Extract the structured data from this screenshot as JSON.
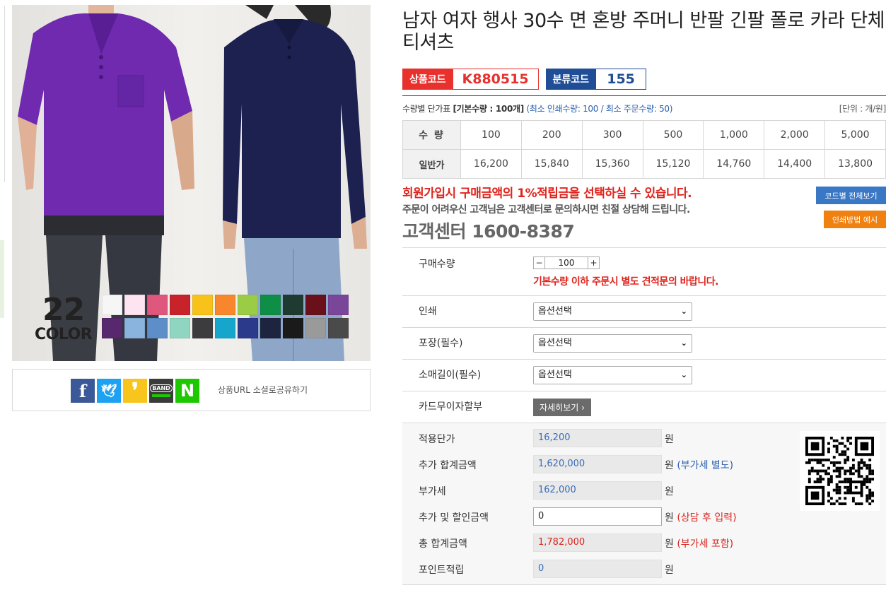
{
  "product": {
    "title": "남자 여자 행사 30수 면 혼방 주머니 반팔 긴팔 폴로 카라 단체 티셔츠",
    "code_label": "상품코드",
    "code_value": "K880515",
    "category_label": "분류코드",
    "category_value": "155"
  },
  "image": {
    "color_count_num": "22",
    "color_count_word": "COLOR",
    "swatches": [
      "#f6f6f6",
      "#fde4f0",
      "#e0577d",
      "#c8222a",
      "#f8c21a",
      "#f7862c",
      "#9bcc45",
      "#0e8e47",
      "#1f3b31",
      "#6a101a",
      "#7a4699",
      "#58286f",
      "#8ab3dd",
      "#5d8ec7",
      "#8fd5bf",
      "#3c3c3e",
      "#16a6cb",
      "#2b3a8a",
      "#1c2440",
      "#1a1a1a",
      "#9a9a9a",
      "#4a4a4a"
    ]
  },
  "share": {
    "label": "상품URL 소셜로공유하기",
    "icons": [
      {
        "name": "facebook",
        "glyph": "f",
        "color": "#3b5998"
      },
      {
        "name": "twitter",
        "glyph": "🐦",
        "color": "#1da1f2"
      },
      {
        "name": "kakaostory",
        "glyph": "❜",
        "color": "#f8c51c"
      },
      {
        "name": "band",
        "glyph": "BAND",
        "color": "#3b3b3b"
      },
      {
        "name": "naver",
        "glyph": "N",
        "color": "#1ec800"
      }
    ]
  },
  "price_info": {
    "prefix": "수량별 단가표 ",
    "base_qty": "[기본수량 : 100개]",
    "min_info": "(최소 인쇄수량: 100 / 최소 주문수량: 50)",
    "unit": "[단위 : 개/원]"
  },
  "price_table": {
    "qty_label": "수 량",
    "price_label": "일반가",
    "quantities": [
      "100",
      "200",
      "300",
      "500",
      "1,000",
      "2,000",
      "5,000"
    ],
    "prices": [
      "16,200",
      "15,840",
      "15,360",
      "15,120",
      "14,760",
      "14,400",
      "13,800"
    ]
  },
  "notices": {
    "promo": "회원가입시 구매금액의 1%적립금을 선택하실 수 있습니다.",
    "inquiry": "주문이 어려우신 고객님은 고객센터로 문의하시면 친절 상담해 드립니다.",
    "cs_center": "고객센터 1600-8387",
    "btn_code_all": "코드별 전체보기",
    "btn_print_example": "인쇄방법 예시"
  },
  "options": {
    "qty_label": "구매수량",
    "qty_minus": "−",
    "qty_value": "100",
    "qty_plus": "+",
    "qty_warning": "기본수량 이하 주문시 별도 견적문의 바랍니다.",
    "print_label": "인쇄",
    "print_value": "옵션선택",
    "packing_label": "포장(필수)",
    "packing_value": "옵션선택",
    "sleeve_label": "소매길이(필수)",
    "sleeve_value": "옵션선택",
    "card_label": "카드무이자할부",
    "card_button": "자세히보기 ›"
  },
  "summary": {
    "unit_price_label": "적용단가",
    "unit_price": "16,200",
    "subtotal_label": "추가 합계금액",
    "subtotal": "1,620,000",
    "subtotal_note": "(부가세 별도)",
    "vat_label": "부가세",
    "vat": "162,000",
    "discount_label": "추가 및 할인금액",
    "discount": "0",
    "discount_note": "(상담 후 입력)",
    "total_label": "총 합계금액",
    "total": "1,782,000",
    "total_note": "(부가세 포함)",
    "points_label": "포인트적립",
    "points": "0",
    "won": "원"
  }
}
